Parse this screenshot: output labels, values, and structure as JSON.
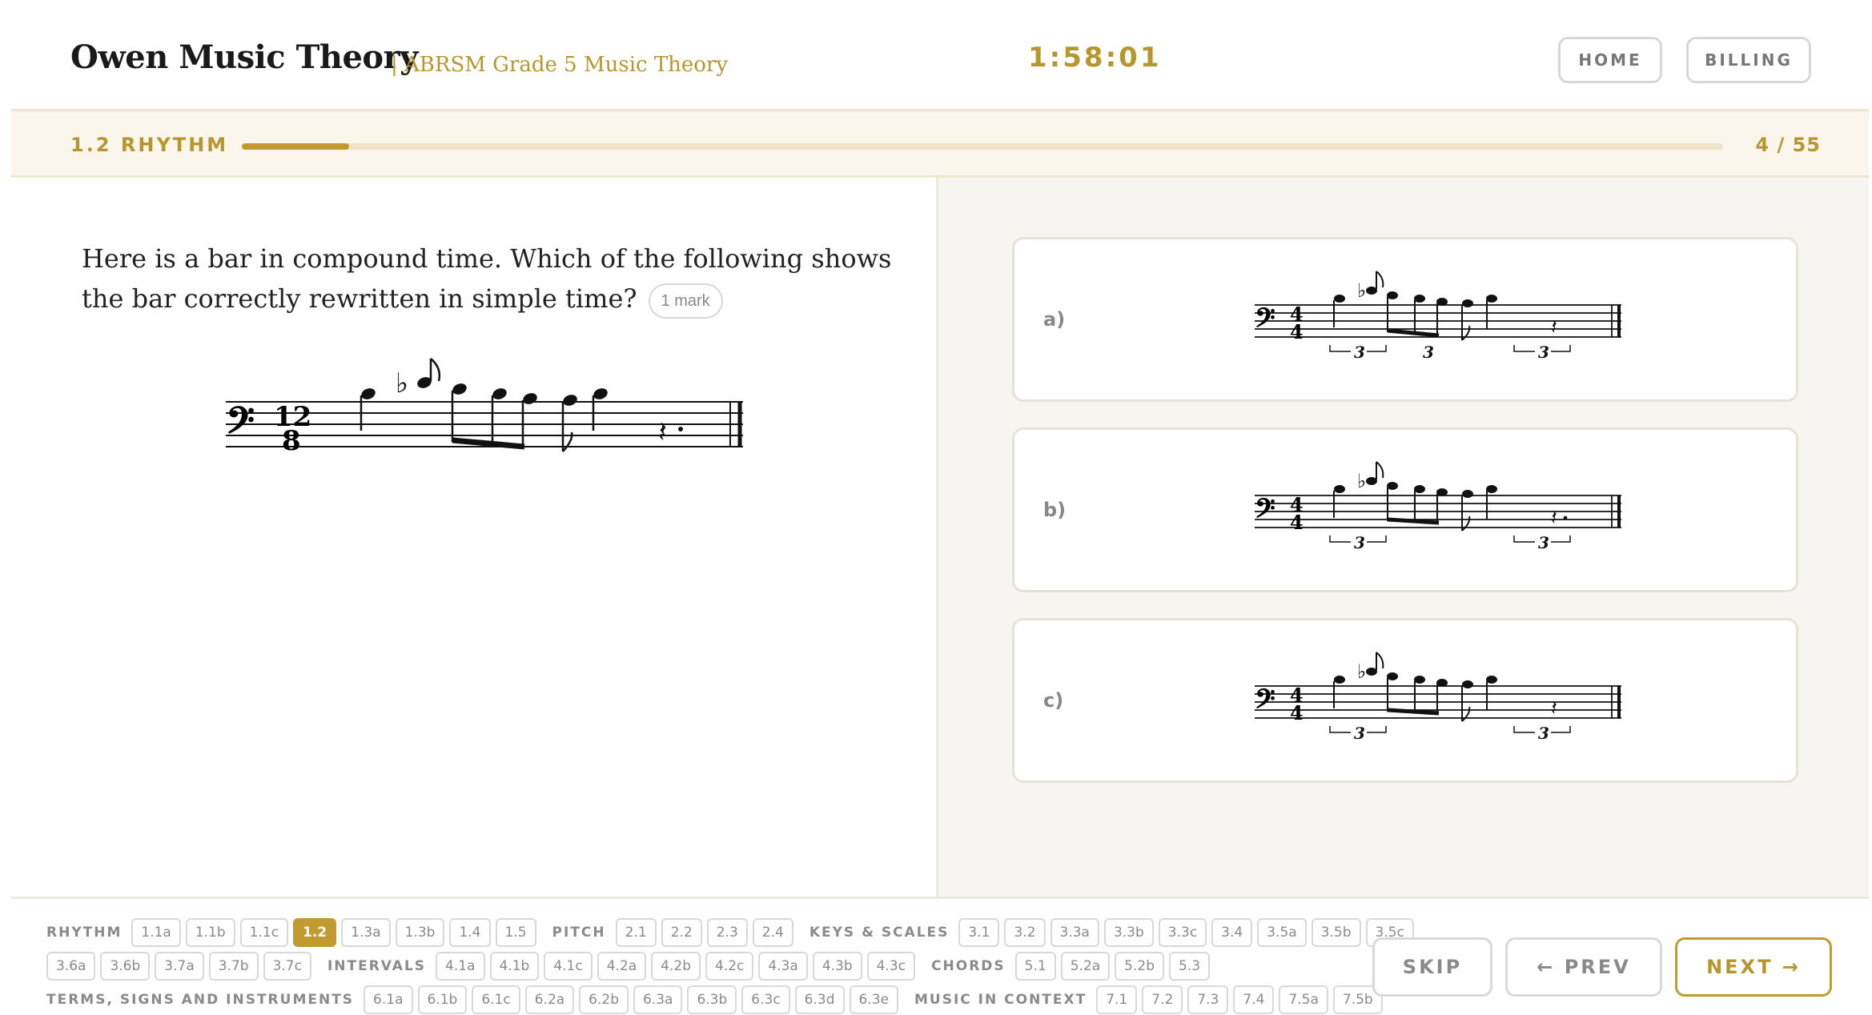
{
  "header": {
    "brand": "Owen Music Theory",
    "subtitle": "| ABRSM Grade 5 Music Theory",
    "timer": "1:58:01",
    "home_label": "HOME",
    "billing_label": "BILLING"
  },
  "progress": {
    "section_label": "1.2 RHYTHM",
    "count": "4 / 55",
    "fraction": 0.0727,
    "accent_color": "#c29b30"
  },
  "question": {
    "text": "Here is a bar in compound time. Which of the following shows the bar correctly rewritten in simple time?",
    "marks": "1 mark",
    "time_signature": {
      "top": "12",
      "bottom": "8"
    }
  },
  "options": [
    {
      "label": "a)",
      "time_signature": {
        "top": "4",
        "bottom": "4"
      },
      "tuplets": [
        "3",
        "3",
        "3"
      ]
    },
    {
      "label": "b)",
      "time_signature": {
        "top": "4",
        "bottom": "4"
      },
      "tuplets": [
        "3",
        "3"
      ]
    },
    {
      "label": "c)",
      "time_signature": {
        "top": "4",
        "bottom": "4"
      },
      "tuplets": [
        "3",
        "3"
      ]
    }
  ],
  "nav": {
    "rows": [
      [
        {
          "section": "RHYTHM"
        },
        {
          "chip": "1.1a"
        },
        {
          "chip": "1.1b"
        },
        {
          "chip": "1.1c"
        },
        {
          "chip": "1.2",
          "active": true
        },
        {
          "chip": "1.3a"
        },
        {
          "chip": "1.3b"
        },
        {
          "chip": "1.4"
        },
        {
          "chip": "1.5"
        },
        {
          "section": "PITCH"
        },
        {
          "chip": "2.1"
        },
        {
          "chip": "2.2"
        },
        {
          "chip": "2.3"
        },
        {
          "chip": "2.4"
        },
        {
          "section": "KEYS & SCALES"
        },
        {
          "chip": "3.1"
        },
        {
          "chip": "3.2"
        },
        {
          "chip": "3.3a"
        },
        {
          "chip": "3.3b"
        },
        {
          "chip": "3.3c"
        },
        {
          "chip": "3.4"
        },
        {
          "chip": "3.5a"
        },
        {
          "chip": "3.5b"
        },
        {
          "chip": "3.5c"
        }
      ],
      [
        {
          "chip": "3.6a"
        },
        {
          "chip": "3.6b"
        },
        {
          "chip": "3.7a"
        },
        {
          "chip": "3.7b"
        },
        {
          "chip": "3.7c"
        },
        {
          "section": "INTERVALS"
        },
        {
          "chip": "4.1a"
        },
        {
          "chip": "4.1b"
        },
        {
          "chip": "4.1c"
        },
        {
          "chip": "4.2a"
        },
        {
          "chip": "4.2b"
        },
        {
          "chip": "4.2c"
        },
        {
          "chip": "4.3a"
        },
        {
          "chip": "4.3b"
        },
        {
          "chip": "4.3c"
        },
        {
          "section": "CHORDS"
        },
        {
          "chip": "5.1"
        },
        {
          "chip": "5.2a"
        },
        {
          "chip": "5.2b"
        },
        {
          "chip": "5.3"
        }
      ],
      [
        {
          "section": "TERMS, SIGNS AND INSTRUMENTS"
        },
        {
          "chip": "6.1a"
        },
        {
          "chip": "6.1b"
        },
        {
          "chip": "6.1c"
        },
        {
          "chip": "6.2a"
        },
        {
          "chip": "6.2b"
        },
        {
          "chip": "6.3a"
        },
        {
          "chip": "6.3b"
        },
        {
          "chip": "6.3c"
        },
        {
          "chip": "6.3d"
        },
        {
          "chip": "6.3e"
        },
        {
          "section": "MUSIC IN CONTEXT"
        },
        {
          "chip": "7.1"
        },
        {
          "chip": "7.2"
        },
        {
          "chip": "7.3"
        },
        {
          "chip": "7.4"
        },
        {
          "chip": "7.5a"
        },
        {
          "chip": "7.5b"
        }
      ]
    ]
  },
  "footer": {
    "skip_label": "SKIP",
    "prev_label": "← PREV",
    "next_label": "NEXT →"
  }
}
